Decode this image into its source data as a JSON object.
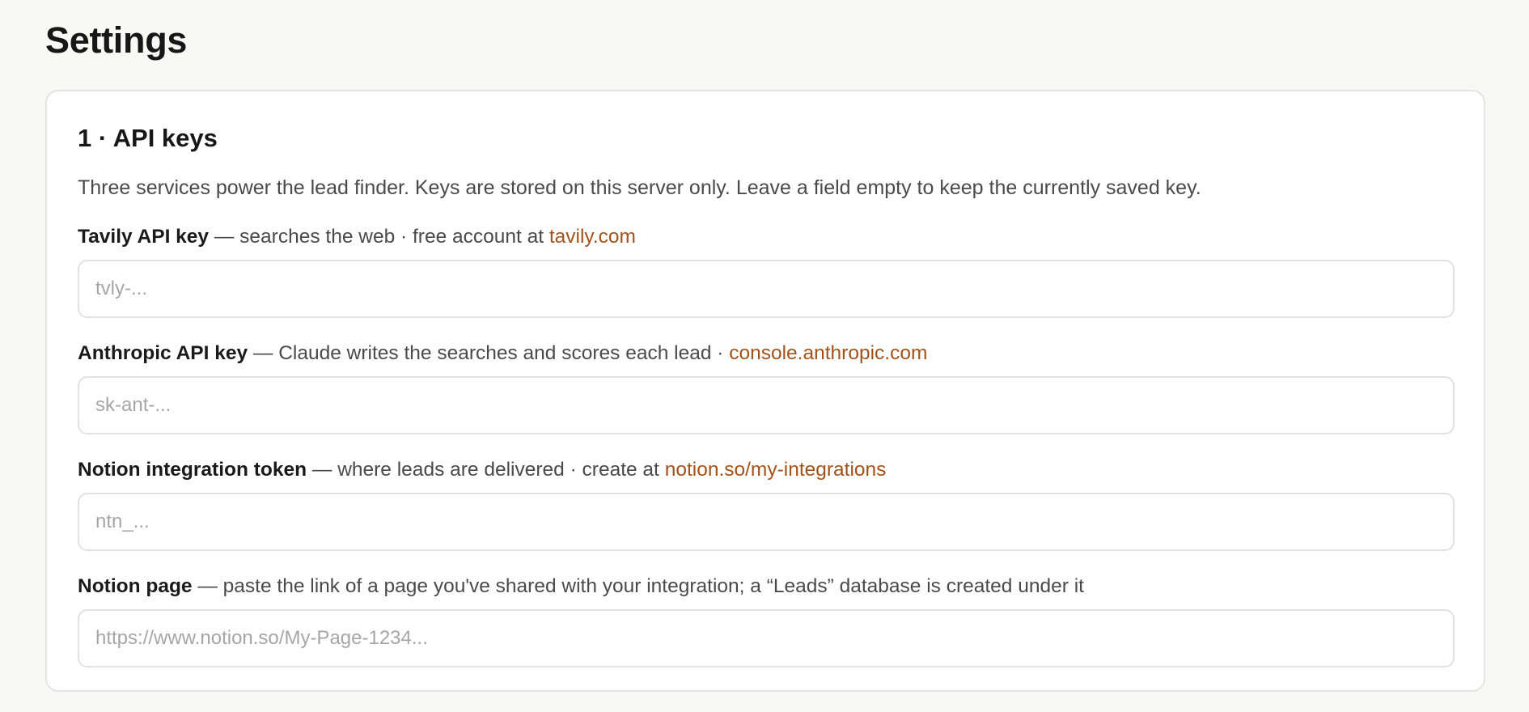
{
  "page": {
    "title": "Settings"
  },
  "section": {
    "title": "1 · API keys",
    "description": "Three services power the lead finder. Keys are stored on this server only. Leave a field empty to keep the currently saved key."
  },
  "fields": [
    {
      "label": "Tavily API key",
      "hint": " — searches the web · free account at ",
      "link": "tavily.com",
      "value": "",
      "placeholder": "tvly-..."
    },
    {
      "label": "Anthropic API key",
      "hint": " — Claude writes the searches and scores each lead · ",
      "link": "console.anthropic.com",
      "value": "",
      "placeholder": "sk-ant-..."
    },
    {
      "label": "Notion integration token",
      "hint": " — where leads are delivered · create at ",
      "link": "notion.so/my-integrations",
      "value": "",
      "placeholder": "ntn_..."
    },
    {
      "label": "Notion page",
      "hint": " — paste the link of a page you've shared with your integration; a “Leads” database is created under it",
      "link": "",
      "value": "",
      "placeholder": "https://www.notion.so/My-Page-1234..."
    }
  ],
  "colors": {
    "background": "#f8f8f7",
    "card": "#ffffff",
    "border": "#e4e4e2",
    "link": "#a4521a",
    "placeholder": "#a6a6a6"
  }
}
